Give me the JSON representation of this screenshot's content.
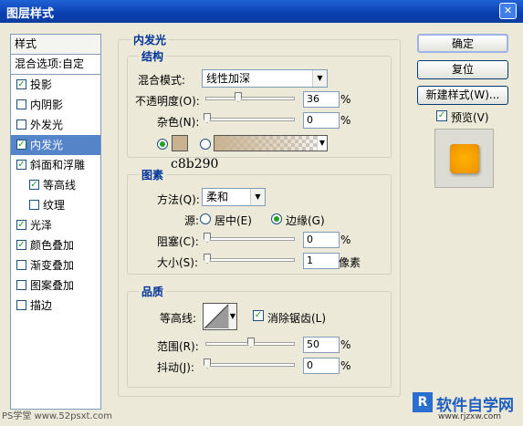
{
  "window": {
    "title": "图层样式"
  },
  "style_list": {
    "header": "样式",
    "blend_options": "混合选项:自定",
    "items": [
      {
        "label": "投影",
        "checked": true
      },
      {
        "label": "内阴影",
        "checked": false
      },
      {
        "label": "外发光",
        "checked": false
      },
      {
        "label": "内发光",
        "checked": true,
        "selected": true
      },
      {
        "label": "斜面和浮雕",
        "checked": true
      },
      {
        "label": "等高线",
        "checked": true,
        "indent": true
      },
      {
        "label": "纹理",
        "checked": false,
        "indent": true
      },
      {
        "label": "光泽",
        "checked": true
      },
      {
        "label": "颜色叠加",
        "checked": true
      },
      {
        "label": "渐变叠加",
        "checked": false
      },
      {
        "label": "图案叠加",
        "checked": false
      },
      {
        "label": "描边",
        "checked": false
      }
    ]
  },
  "inner_glow": {
    "title": "内发光",
    "structure": {
      "legend": "结构",
      "blend_mode_label": "混合模式:",
      "blend_mode_value": "线性加深",
      "opacity_label": "不透明度(O):",
      "opacity_value": "36",
      "noise_label": "杂色(N):",
      "noise_value": "0",
      "percent": "%",
      "color_hex": "c8b290",
      "swatch_color": "#c8b290"
    },
    "elements": {
      "legend": "图素",
      "technique_label": "方法(Q):",
      "technique_value": "柔和",
      "source_label": "源:",
      "source_center": "居中(E)",
      "source_edge": "边缘(G)",
      "choke_label": "阻塞(C):",
      "choke_value": "0",
      "size_label": "大小(S):",
      "size_value": "1",
      "size_unit": "像素"
    },
    "quality": {
      "legend": "品质",
      "contour_label": "等高线:",
      "antialias_label": "消除锯齿(L)",
      "range_label": "范围(R):",
      "range_value": "50",
      "jitter_label": "抖动(J):",
      "jitter_value": "0"
    }
  },
  "buttons": {
    "ok": "确定",
    "reset": "复位",
    "new_style": "新建样式(W)...",
    "preview_label": "预览(V)"
  },
  "watermarks": {
    "left": "PS学堂 www.52psxt.com",
    "right_brand": "软件自学网",
    "right_url": "www.rjzxw.com"
  }
}
